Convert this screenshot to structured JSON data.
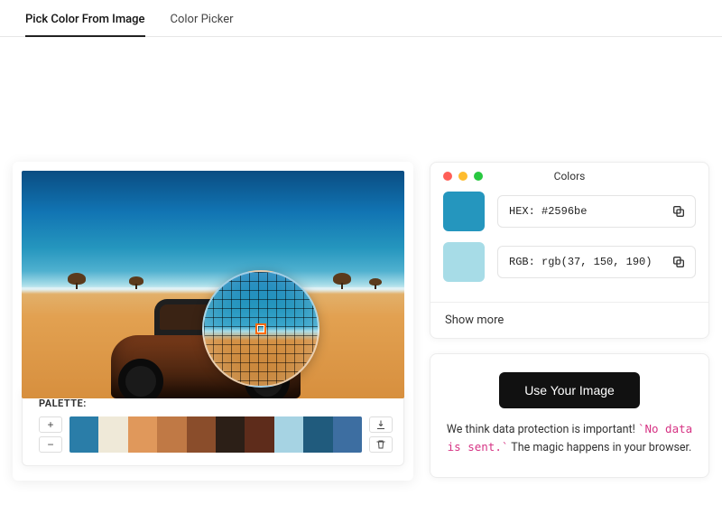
{
  "tabs": {
    "pick": "Pick Color From Image",
    "picker": "Color Picker"
  },
  "palette": {
    "label": "PALETTE:",
    "colors": [
      "#2a7da8",
      "#efe9d8",
      "#e0985b",
      "#c07945",
      "#8a4d2b",
      "#2c1f17",
      "#5e2c1b",
      "#a6d3e3",
      "#205b7d",
      "#3d6ea1"
    ]
  },
  "colors_panel": {
    "title": "Colors",
    "swatch_hex": "#2596be",
    "swatch_rgb_color": "#a7dce7",
    "hex_label": "HEX:",
    "hex_value": "#2596be",
    "rgb_label": "RGB:",
    "rgb_value": "rgb(37, 150, 190)",
    "show_more": "Show more"
  },
  "cta": {
    "button": "Use Your Image",
    "line1_a": "We think data protection is important! ",
    "line1_code": "`No data is sent.`",
    "line1_b": " The magic happens in your browser."
  }
}
